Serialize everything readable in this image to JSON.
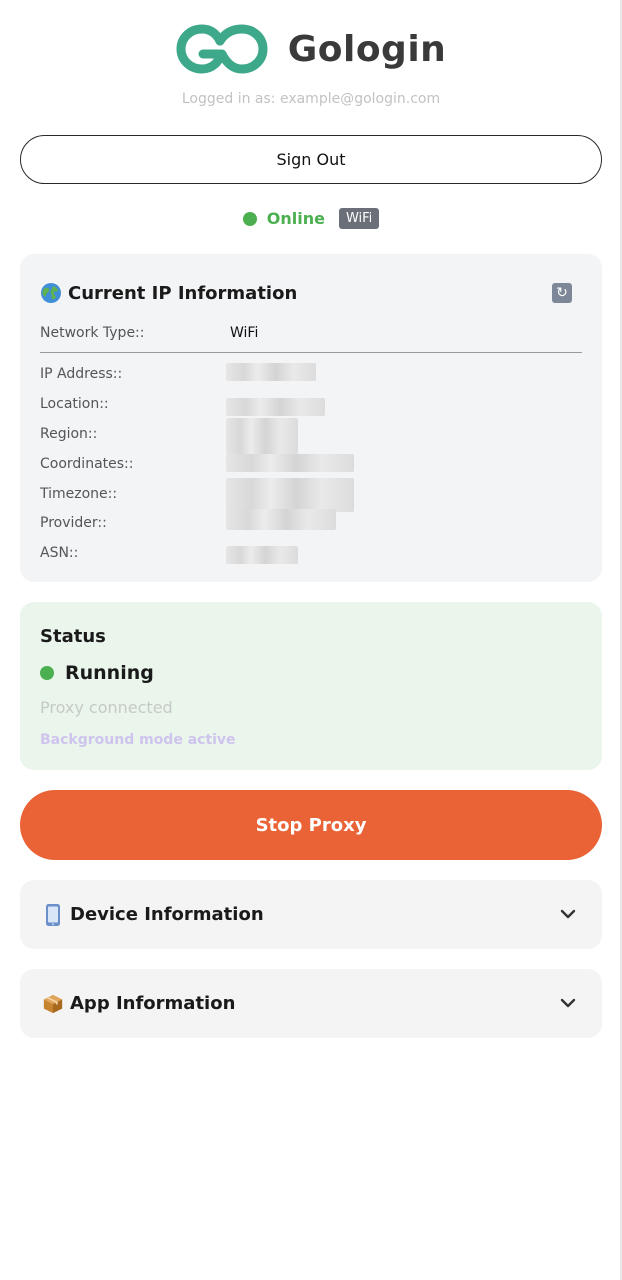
{
  "header": {
    "brand_name": "Gologin",
    "logged_in_text": "Logged in as: example@gologin.com",
    "logo_icon": "gologin-logo-icon"
  },
  "account": {
    "sign_out_label": "Sign Out"
  },
  "connection": {
    "status_text": "Online",
    "network_badge": "WiFi",
    "status_color": "#4caf50"
  },
  "ip_info": {
    "title": "Current IP Information",
    "title_icon": "globe-icon",
    "refresh_icon": "refresh-icon",
    "rows": [
      {
        "label": "Network Type::",
        "value": "WiFi"
      },
      {
        "label": "IP Address::",
        "value": ""
      },
      {
        "label": "Location::",
        "value": ""
      },
      {
        "label": "Region::",
        "value": ""
      },
      {
        "label": "Coordinates::",
        "value": ""
      },
      {
        "label": "Timezone::",
        "value": ""
      },
      {
        "label": "Provider::",
        "value": ""
      },
      {
        "label": "ASN::",
        "value": ""
      }
    ]
  },
  "status": {
    "title": "Status",
    "state": "Running",
    "detail": "Proxy connected",
    "background_mode": "Background mode active",
    "state_color": "#4caf50"
  },
  "actions": {
    "stop_proxy_label": "Stop Proxy",
    "stop_proxy_color": "#ea6337"
  },
  "sections": {
    "device_info": {
      "label": "Device Information",
      "icon": "phone-icon"
    },
    "app_info": {
      "label": "App Information",
      "icon": "package-icon"
    }
  }
}
